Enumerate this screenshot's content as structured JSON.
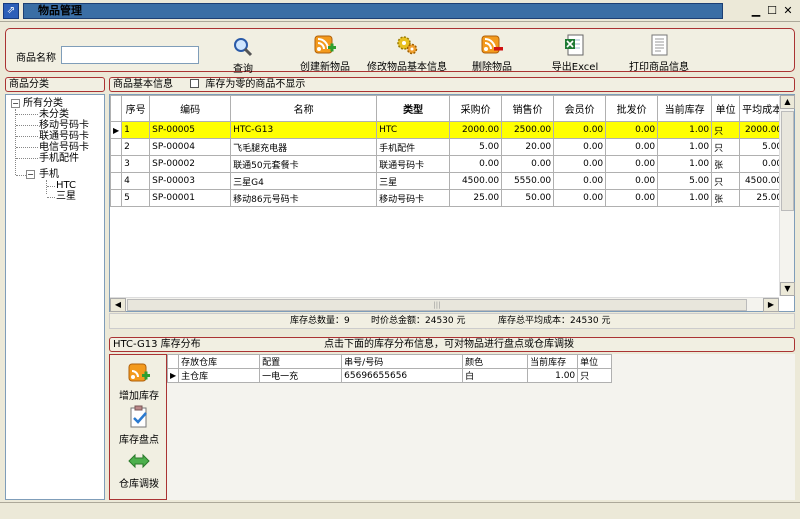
{
  "window": {
    "title": "物品管理",
    "app_icon_glyph": "⇗",
    "controls": {
      "minimize": "▁",
      "maximize": "☐",
      "close": "✕"
    }
  },
  "toolbar": {
    "search_label": "商品名称",
    "search_value": "",
    "buttons": {
      "query": "查询",
      "create": "创建新物品",
      "edit": "修改物品基本信息",
      "delete": "删除物品",
      "export": "导出Excel",
      "print": "打印商品信息"
    }
  },
  "category_panel": {
    "header": "商品分类",
    "tree": {
      "root": "所有分类",
      "expander_open": "−",
      "children": [
        "未分类",
        "移动号码卡",
        "联通号码卡",
        "电信号码卡",
        "手机配件",
        "手机"
      ],
      "phone_children": [
        "HTC",
        "三星"
      ]
    }
  },
  "info_panel": {
    "header": "商品基本信息",
    "hide_zero_stock_label": "库存为零的商品不显示"
  },
  "products": {
    "columns": [
      "序号",
      "编码",
      "名称",
      "类型",
      "采购价",
      "销售价",
      "会员价",
      "批发价",
      "当前库存",
      "单位",
      "平均成本"
    ],
    "row_marker": "▶",
    "rows": [
      [
        "1",
        "SP-00005",
        "HTC-G13",
        "HTC",
        "2000.00",
        "2500.00",
        "0.00",
        "0.00",
        "1.00",
        "只",
        "2000.00"
      ],
      [
        "2",
        "SP-00004",
        "飞毛腿充电器",
        "手机配件",
        "5.00",
        "20.00",
        "0.00",
        "0.00",
        "1.00",
        "只",
        "5.00"
      ],
      [
        "3",
        "SP-00002",
        "联通50元套餐卡",
        "联通号码卡",
        "0.00",
        "0.00",
        "0.00",
        "0.00",
        "1.00",
        "张",
        "0.00"
      ],
      [
        "4",
        "SP-00003",
        "三星G4",
        "三星",
        "4500.00",
        "5550.00",
        "0.00",
        "0.00",
        "5.00",
        "只",
        "4500.00"
      ],
      [
        "5",
        "SP-00001",
        "移动86元号码卡",
        "移动号码卡",
        "25.00",
        "50.00",
        "0.00",
        "0.00",
        "1.00",
        "张",
        "25.00"
      ]
    ],
    "scroll_glyphs": {
      "up": "▲",
      "down": "▼",
      "left": "◀",
      "right": "▶",
      "grip": "|||"
    }
  },
  "summary": {
    "total_qty": "库存总数量：9",
    "total_amount": "时价总金额：24530 元",
    "avg_cost": "库存总平均成本：24530 元"
  },
  "stock_panel": {
    "header": "HTC-G13 库存分布",
    "hint": "点击下面的库存分布信息，可对物品进行盘点或仓库调拨",
    "buttons": {
      "add": "增加库存",
      "check": "库存盘点",
      "transfer": "仓库调拨"
    },
    "columns": [
      "存放仓库",
      "配置",
      "串号/号码",
      "颜色",
      "当前库存",
      "单位"
    ],
    "rows": [
      [
        "主仓库",
        "一电一充",
        "65696655656",
        "白",
        "1.00",
        "只"
      ]
    ]
  },
  "colors": {
    "selected_row": "#ffff00",
    "panel_border": "#aa3333",
    "title_bar": "#3a6ea5"
  }
}
